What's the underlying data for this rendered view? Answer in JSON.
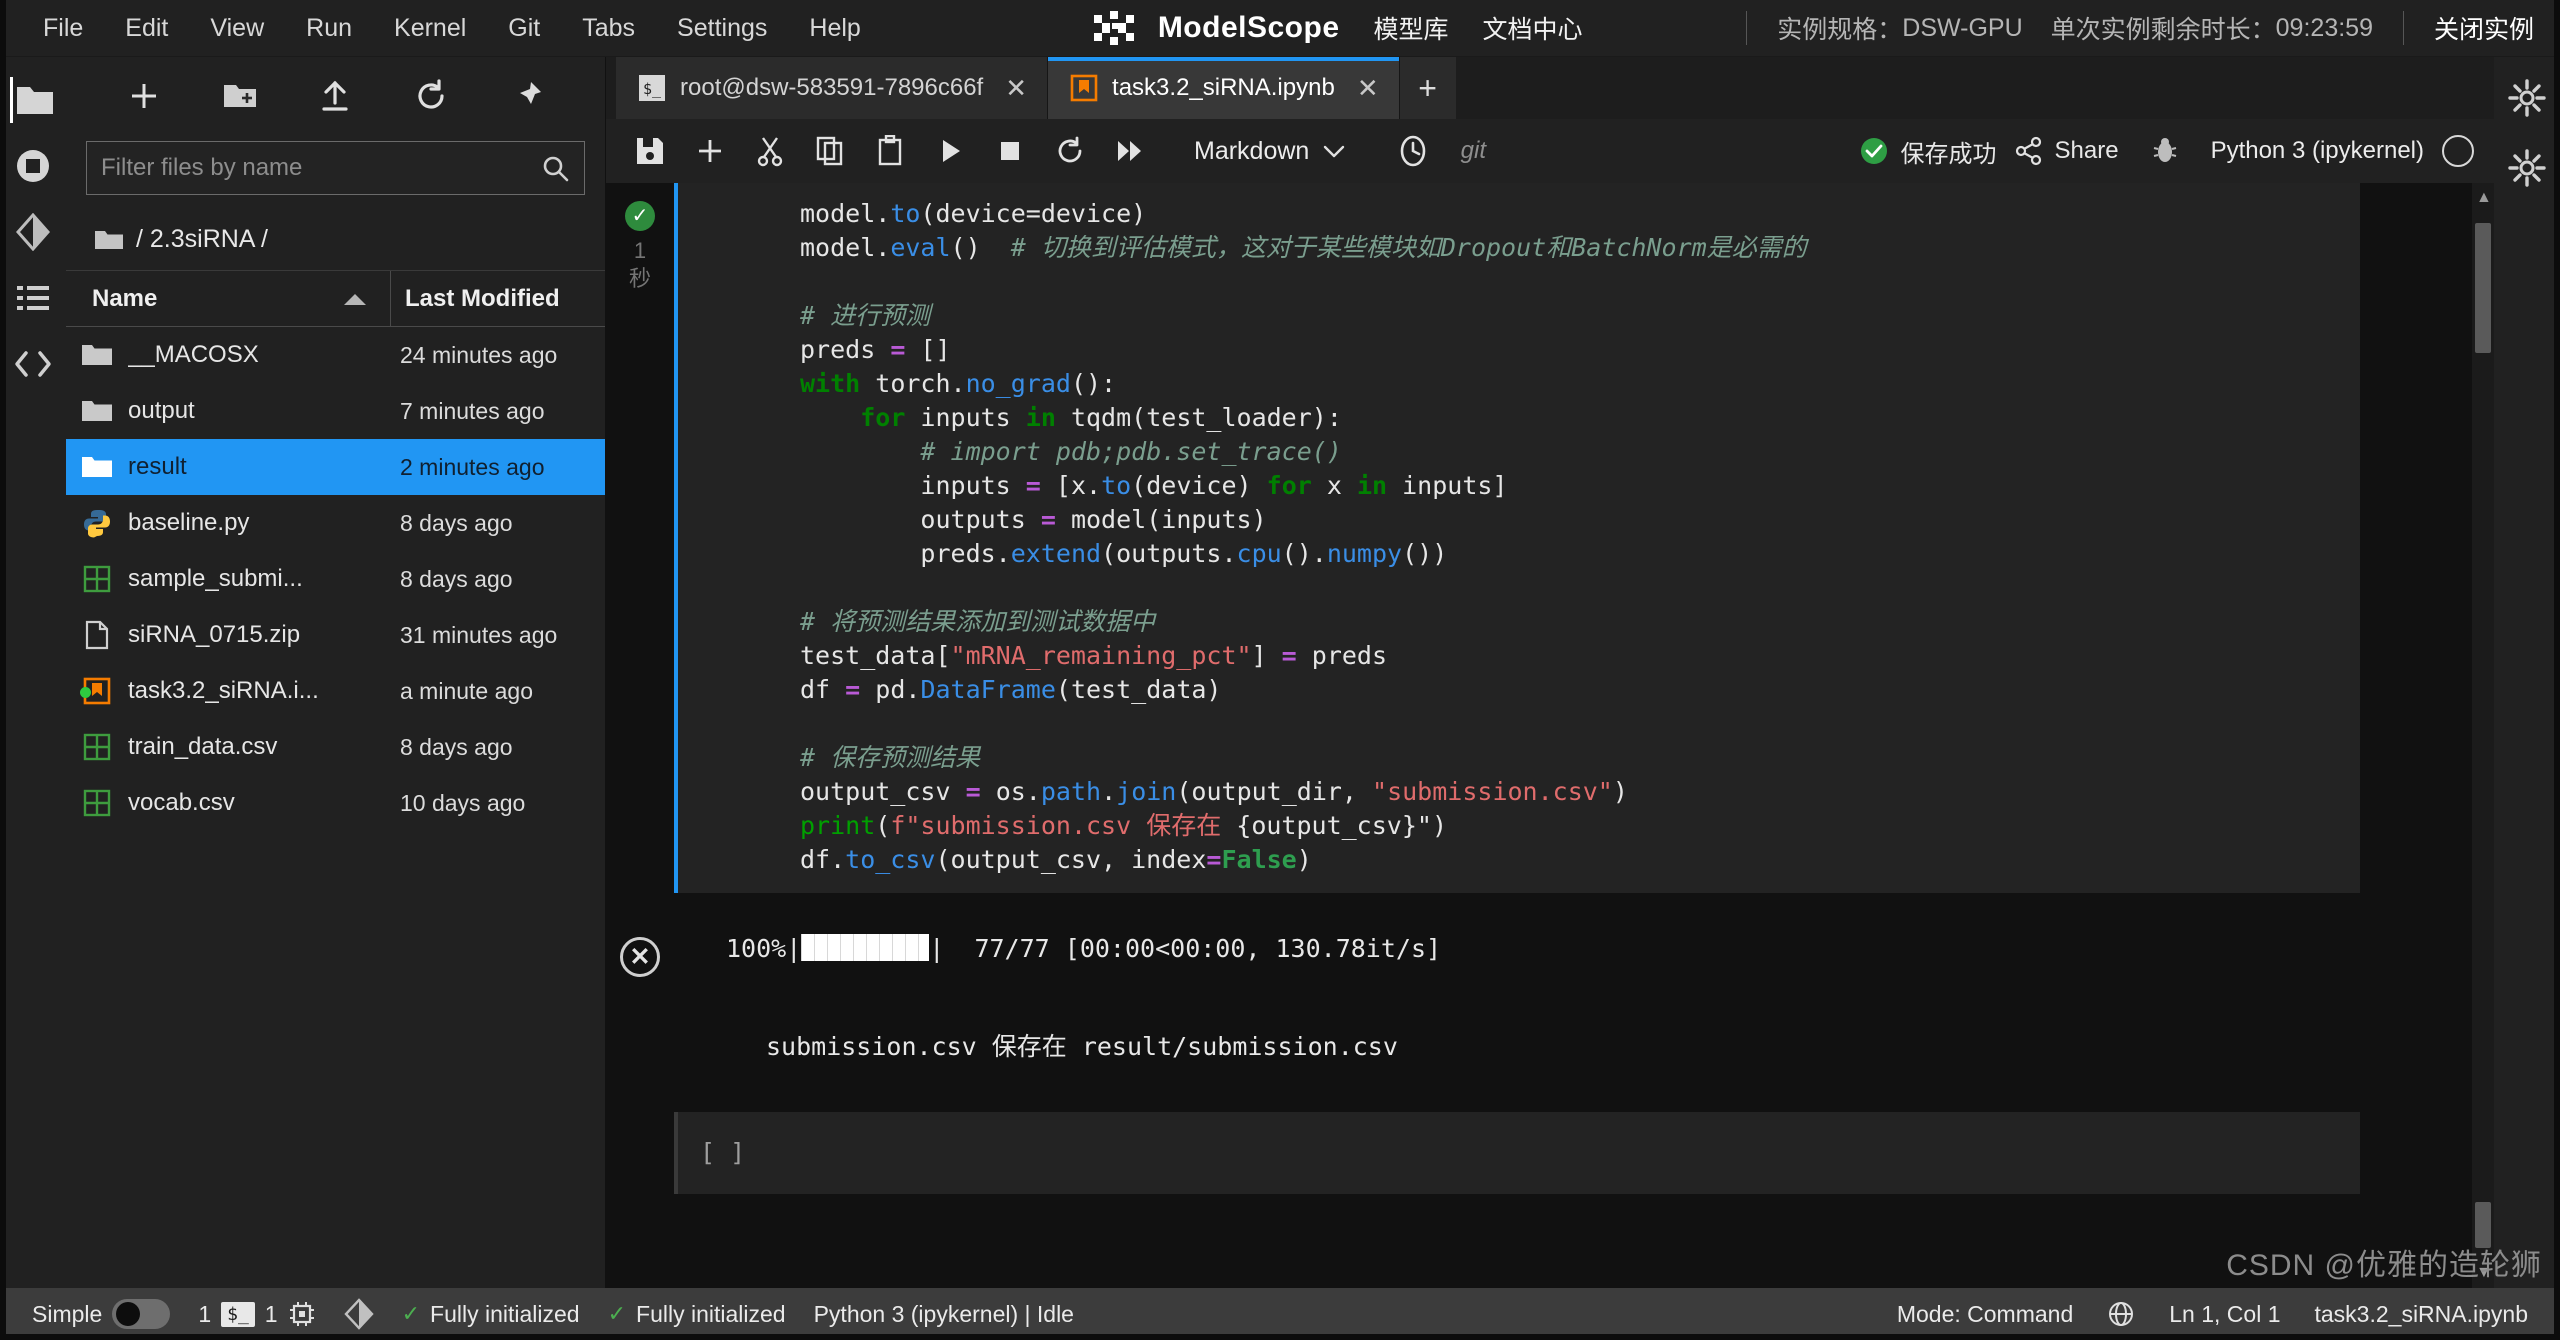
{
  "menubar": {
    "items": [
      {
        "label": "File",
        "name": "menu-file"
      },
      {
        "label": "Edit",
        "name": "menu-edit"
      },
      {
        "label": "View",
        "name": "menu-view"
      },
      {
        "label": "Run",
        "name": "menu-run"
      },
      {
        "label": "Kernel",
        "name": "menu-kernel"
      },
      {
        "label": "Git",
        "name": "menu-git"
      },
      {
        "label": "Tabs",
        "name": "menu-tabs"
      },
      {
        "label": "Settings",
        "name": "menu-settings"
      },
      {
        "label": "Help",
        "name": "menu-help"
      }
    ],
    "brand": "ModelScope",
    "links": [
      "模型库",
      "文档中心"
    ],
    "instance_spec_label": "实例规格：",
    "instance_spec_value": "DSW-GPU",
    "remaining_label": "单次实例剩余时长：",
    "remaining_value": "09:23:59",
    "close_instance": "关闭实例"
  },
  "filebrowser": {
    "filter_placeholder": "Filter files by name",
    "filter_value": "",
    "breadcrumb": "/ 2.3siRNA /",
    "col_name": "Name",
    "col_modified": "Last Modified",
    "rows": [
      {
        "name": "__MACOSX",
        "modified": "24 minutes ago",
        "icon": "folder-icon",
        "selected": false,
        "dirty": false
      },
      {
        "name": "output",
        "modified": "7 minutes ago",
        "icon": "folder-icon",
        "selected": false,
        "dirty": false
      },
      {
        "name": "result",
        "modified": "2 minutes ago",
        "icon": "folder-icon",
        "selected": true,
        "dirty": false
      },
      {
        "name": "baseline.py",
        "modified": "8 days ago",
        "icon": "python-icon",
        "selected": false,
        "dirty": false
      },
      {
        "name": "sample_submi...",
        "modified": "8 days ago",
        "icon": "csv-icon",
        "selected": false,
        "dirty": false
      },
      {
        "name": "siRNA_0715.zip",
        "modified": "31 minutes ago",
        "icon": "file-icon",
        "selected": false,
        "dirty": false
      },
      {
        "name": "task3.2_siRNA.i...",
        "modified": "a minute ago",
        "icon": "notebook-icon",
        "selected": false,
        "dirty": true
      },
      {
        "name": "train_data.csv",
        "modified": "8 days ago",
        "icon": "csv-icon",
        "selected": false,
        "dirty": false
      },
      {
        "name": "vocab.csv",
        "modified": "10 days ago",
        "icon": "csv-icon",
        "selected": false,
        "dirty": false
      }
    ]
  },
  "tabs": [
    {
      "label": "root@dsw-583591-7896c66f",
      "icon": "terminal-icon",
      "active": false
    },
    {
      "label": "task3.2_siRNA.ipynb",
      "icon": "notebook-icon",
      "active": true
    }
  ],
  "toolbar": {
    "cell_type": "Markdown",
    "git_label": "git",
    "save_status": "保存成功",
    "share_label": "Share",
    "kernel_label": "Python 3 (ipykernel)"
  },
  "notebook": {
    "exec_count": "1",
    "exec_unit": "秒",
    "empty_cell_prompt": "[ ]",
    "output": {
      "progress_pct": "100%",
      "progress_counts": "77/77",
      "progress_timing": "[00:00<00:00, 130.78it/s]",
      "print_line": "submission.csv 保存在 result/submission.csv"
    },
    "code_lines": [
      [
        [
          "model.to(",
          "plain"
        ],
        [
          "to",
          "skip"
        ]
      ],
      []
    ]
  },
  "code": {
    "lines": [
      {
        "indent": 0,
        "tokens": [
          [
            "model.",
            "plain"
          ],
          [
            "to",
            "fn"
          ],
          [
            "(device=device)",
            "plain"
          ]
        ]
      },
      {
        "indent": 0,
        "tokens": [
          [
            "model.",
            "plain"
          ],
          [
            "eval",
            "fn"
          ],
          [
            "()",
            "plain"
          ],
          [
            "  # 切换到评估模式，这对于某些模块如Dropout和BatchNorm是必需的",
            "cmt"
          ]
        ]
      },
      {
        "indent": 0,
        "tokens": []
      },
      {
        "indent": 0,
        "tokens": [
          [
            "# 进行预测",
            "cmt"
          ]
        ]
      },
      {
        "indent": 0,
        "tokens": [
          [
            "preds ",
            "plain"
          ],
          [
            "=",
            "op"
          ],
          [
            " []",
            "plain"
          ]
        ]
      },
      {
        "indent": 0,
        "tokens": [
          [
            "with",
            "kw"
          ],
          [
            " torch.",
            "plain"
          ],
          [
            "no_grad",
            "fn"
          ],
          [
            "():",
            "plain"
          ]
        ]
      },
      {
        "indent": 1,
        "tokens": [
          [
            "for",
            "kw"
          ],
          [
            " inputs ",
            "plain"
          ],
          [
            "in",
            "kw"
          ],
          [
            " tqdm(test_loader):",
            "plain"
          ]
        ]
      },
      {
        "indent": 2,
        "tokens": [
          [
            "# import pdb;pdb.set_trace()",
            "cmt"
          ]
        ]
      },
      {
        "indent": 2,
        "tokens": [
          [
            "inputs ",
            "plain"
          ],
          [
            "=",
            "op"
          ],
          [
            " [x.",
            "plain"
          ],
          [
            "to",
            "fn"
          ],
          [
            "(device) ",
            "plain"
          ],
          [
            "for",
            "kw"
          ],
          [
            " x ",
            "plain"
          ],
          [
            "in",
            "kw"
          ],
          [
            " inputs]",
            "plain"
          ]
        ]
      },
      {
        "indent": 2,
        "tokens": [
          [
            "outputs ",
            "plain"
          ],
          [
            "=",
            "op"
          ],
          [
            " model(inputs)",
            "plain"
          ]
        ]
      },
      {
        "indent": 2,
        "tokens": [
          [
            "preds.",
            "plain"
          ],
          [
            "extend",
            "fn"
          ],
          [
            "(outputs.",
            "plain"
          ],
          [
            "cpu",
            "fn"
          ],
          [
            "().",
            "plain"
          ],
          [
            "numpy",
            "fn"
          ],
          [
            "())",
            "plain"
          ]
        ]
      },
      {
        "indent": 0,
        "tokens": []
      },
      {
        "indent": 0,
        "tokens": [
          [
            "# 将预测结果添加到测试数据中",
            "cmt"
          ]
        ]
      },
      {
        "indent": 0,
        "tokens": [
          [
            "test_data[",
            "plain"
          ],
          [
            "\"mRNA_remaining_pct\"",
            "str"
          ],
          [
            "] ",
            "plain"
          ],
          [
            "=",
            "op"
          ],
          [
            " preds",
            "plain"
          ]
        ]
      },
      {
        "indent": 0,
        "tokens": [
          [
            "df ",
            "plain"
          ],
          [
            "=",
            "op"
          ],
          [
            " pd.",
            "plain"
          ],
          [
            "DataFrame",
            "fn"
          ],
          [
            "(test_data)",
            "plain"
          ]
        ]
      },
      {
        "indent": 0,
        "tokens": []
      },
      {
        "indent": 0,
        "tokens": [
          [
            "# 保存预测结果",
            "cmt"
          ]
        ]
      },
      {
        "indent": 0,
        "tokens": [
          [
            "output_csv ",
            "plain"
          ],
          [
            "=",
            "op"
          ],
          [
            " os.",
            "plain"
          ],
          [
            "path",
            "fn"
          ],
          [
            ".",
            "plain"
          ],
          [
            "join",
            "fn"
          ],
          [
            "(output_dir, ",
            "plain"
          ],
          [
            "\"submission.csv\"",
            "str"
          ],
          [
            ")",
            "plain"
          ]
        ]
      },
      {
        "indent": 0,
        "tokens": [
          [
            "print",
            "kw2"
          ],
          [
            "(",
            "plain"
          ],
          [
            "f\"submission.csv 保存在 ",
            "str"
          ],
          [
            "{output_csv}\"",
            "plain"
          ],
          [
            ")",
            "plain"
          ]
        ]
      },
      {
        "indent": 0,
        "tokens": [
          [
            "df.",
            "plain"
          ],
          [
            "to_csv",
            "fn"
          ],
          [
            "(output_csv, index",
            "plain"
          ],
          [
            "=",
            "op"
          ],
          [
            "False",
            "const"
          ],
          [
            ")",
            "plain"
          ]
        ]
      }
    ]
  },
  "statusbar": {
    "mode_simple": "Simple",
    "kernel_count": "1",
    "terminal_count": "1",
    "status_1": "Fully initialized",
    "status_2": "Fully initialized",
    "kernel_status": "Python 3 (ipykernel) | Idle",
    "mode": "Mode: Command",
    "cursor": "Ln 1, Col 1",
    "filename": "task3.2_siRNA.ipynb"
  },
  "watermark": "CSDN @优雅的造轮狮"
}
